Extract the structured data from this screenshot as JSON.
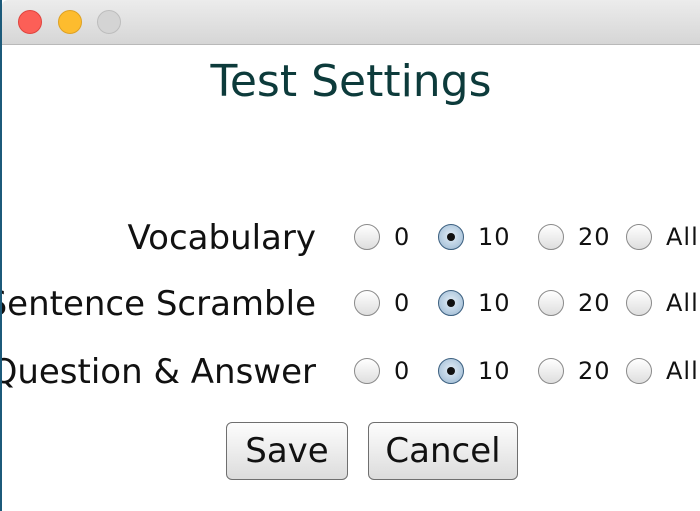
{
  "window": {
    "controls": [
      "close",
      "minimize",
      "zoom"
    ],
    "colors": {
      "close": "#fc5f57",
      "minimize": "#fdbc2e",
      "zoom": "#d4d4d4"
    }
  },
  "title": "Test Settings",
  "settings": [
    {
      "label": "Vocabulary",
      "options": [
        "0",
        "10",
        "20",
        "All"
      ],
      "selected": "10"
    },
    {
      "label": "Sentence Scramble",
      "options": [
        "0",
        "10",
        "20",
        "All"
      ],
      "selected": "10"
    },
    {
      "label": "Question & Answer",
      "options": [
        "0",
        "10",
        "20",
        "All"
      ],
      "selected": "10"
    }
  ],
  "buttons": {
    "save": "Save",
    "cancel": "Cancel"
  },
  "colors": {
    "title": "#0d3b3b",
    "radio_selected": "#b9cfe2"
  }
}
